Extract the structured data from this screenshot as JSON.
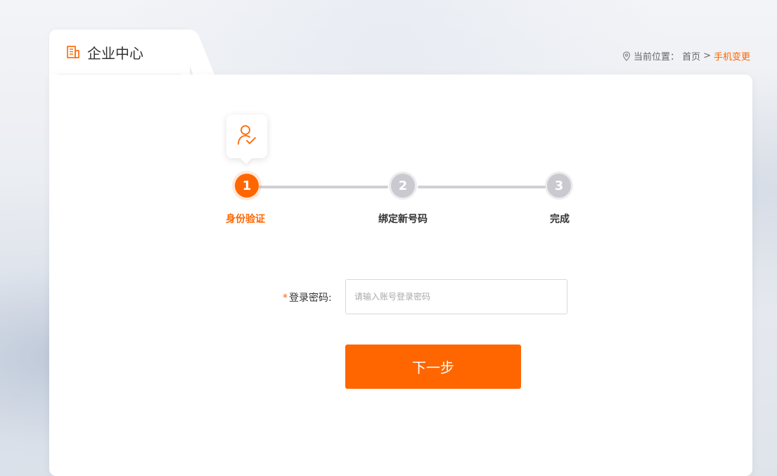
{
  "header": {
    "title": "企业中心",
    "icon": "building-icon"
  },
  "breadcrumb": {
    "icon": "location-pin-icon",
    "prefix": "当前位置：",
    "home": "首页",
    "separator": ">",
    "current": "手机变更"
  },
  "steps": [
    {
      "number": "1",
      "label": "身份验证",
      "active": true
    },
    {
      "number": "2",
      "label": "绑定新号码",
      "active": false
    },
    {
      "number": "3",
      "label": "完成",
      "active": false
    }
  ],
  "form": {
    "required_mark": "*",
    "password_label": "登录密码:",
    "password_placeholder": "请输入账号登录密码",
    "password_value": ""
  },
  "actions": {
    "next_label": "下一步"
  },
  "colors": {
    "accent": "#ff6600",
    "inactive_step": "#c9c9cf",
    "text": "#333333"
  }
}
